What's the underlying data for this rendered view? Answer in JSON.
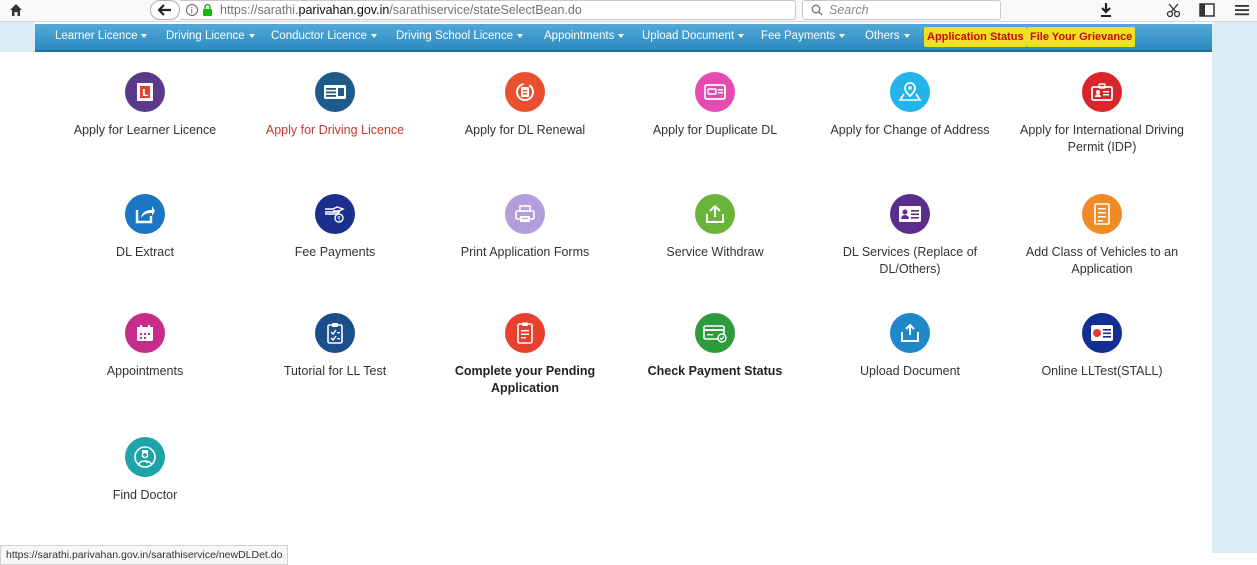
{
  "browser": {
    "url_prefix": "https://sarathi.",
    "url_host": "parivahan.gov.in",
    "url_path": "/sarathiservice/stateSelectBean.do",
    "search_placeholder": "Search"
  },
  "nav": {
    "items": [
      {
        "label": "Learner Licence"
      },
      {
        "label": "Driving Licence"
      },
      {
        "label": "Conductor Licence"
      },
      {
        "label": "Driving School Licence"
      },
      {
        "label": "Appointments"
      },
      {
        "label": "Upload Document"
      },
      {
        "label": "Fee Payments"
      },
      {
        "label": "Others"
      }
    ],
    "application_status": "Application Status",
    "grievance": "File Your Grievance"
  },
  "services": [
    {
      "label": "Apply for Learner Licence",
      "icon": "learner-licence-icon",
      "color": "#5b3a8c"
    },
    {
      "label": "Apply for Driving Licence",
      "icon": "driving-licence-card-icon",
      "color": "#1e5a8a"
    },
    {
      "label": "Apply for DL Renewal",
      "icon": "renewal-icon",
      "color": "#e8502f"
    },
    {
      "label": "Apply for Duplicate DL",
      "icon": "duplicate-card-icon",
      "color": "#e54bb1"
    },
    {
      "label": "Apply for Change of Address",
      "icon": "map-pin-icon",
      "color": "#25b3ec"
    },
    {
      "label": "Apply for International Driving Permit (IDP)",
      "icon": "idp-card-icon",
      "color": "#d9262b"
    },
    {
      "label": "DL Extract",
      "icon": "share-extract-icon",
      "color": "#1a77c4"
    },
    {
      "label": "Fee Payments",
      "icon": "hand-payment-icon",
      "color": "#1c2f8f"
    },
    {
      "label": "Print Application Forms",
      "icon": "printer-icon",
      "color": "#b39ddb"
    },
    {
      "label": "Service Withdraw",
      "icon": "upload-tray-icon",
      "color": "#6bb43b"
    },
    {
      "label": "DL Services (Replace of DL/Others)",
      "icon": "id-card-icon",
      "color": "#5a2d8e"
    },
    {
      "label": "Add Class of Vehicles to an Application",
      "icon": "form-list-icon",
      "color": "#f08a24"
    },
    {
      "label": "Appointments",
      "icon": "calendar-icon",
      "color": "#c72c8a"
    },
    {
      "label": "Tutorial for LL Test",
      "icon": "clipboard-checklist-icon",
      "color": "#1b4f8c"
    },
    {
      "label": "Complete your Pending Application",
      "icon": "document-pending-icon",
      "color": "#e8402f"
    },
    {
      "label": "Check Payment Status",
      "icon": "payment-card-check-icon",
      "color": "#2e9a3e"
    },
    {
      "label": "Upload Document",
      "icon": "upload-document-icon",
      "color": "#1e88c8"
    },
    {
      "label": "Online LLTest(STALL)",
      "icon": "online-test-icon",
      "color": "#142f94"
    },
    {
      "label": "Find Doctor",
      "icon": "doctor-icon",
      "color": "#1ea3a8"
    }
  ],
  "status_url": "https://sarathi.parivahan.gov.in/sarathiservice/newDLDet.do"
}
